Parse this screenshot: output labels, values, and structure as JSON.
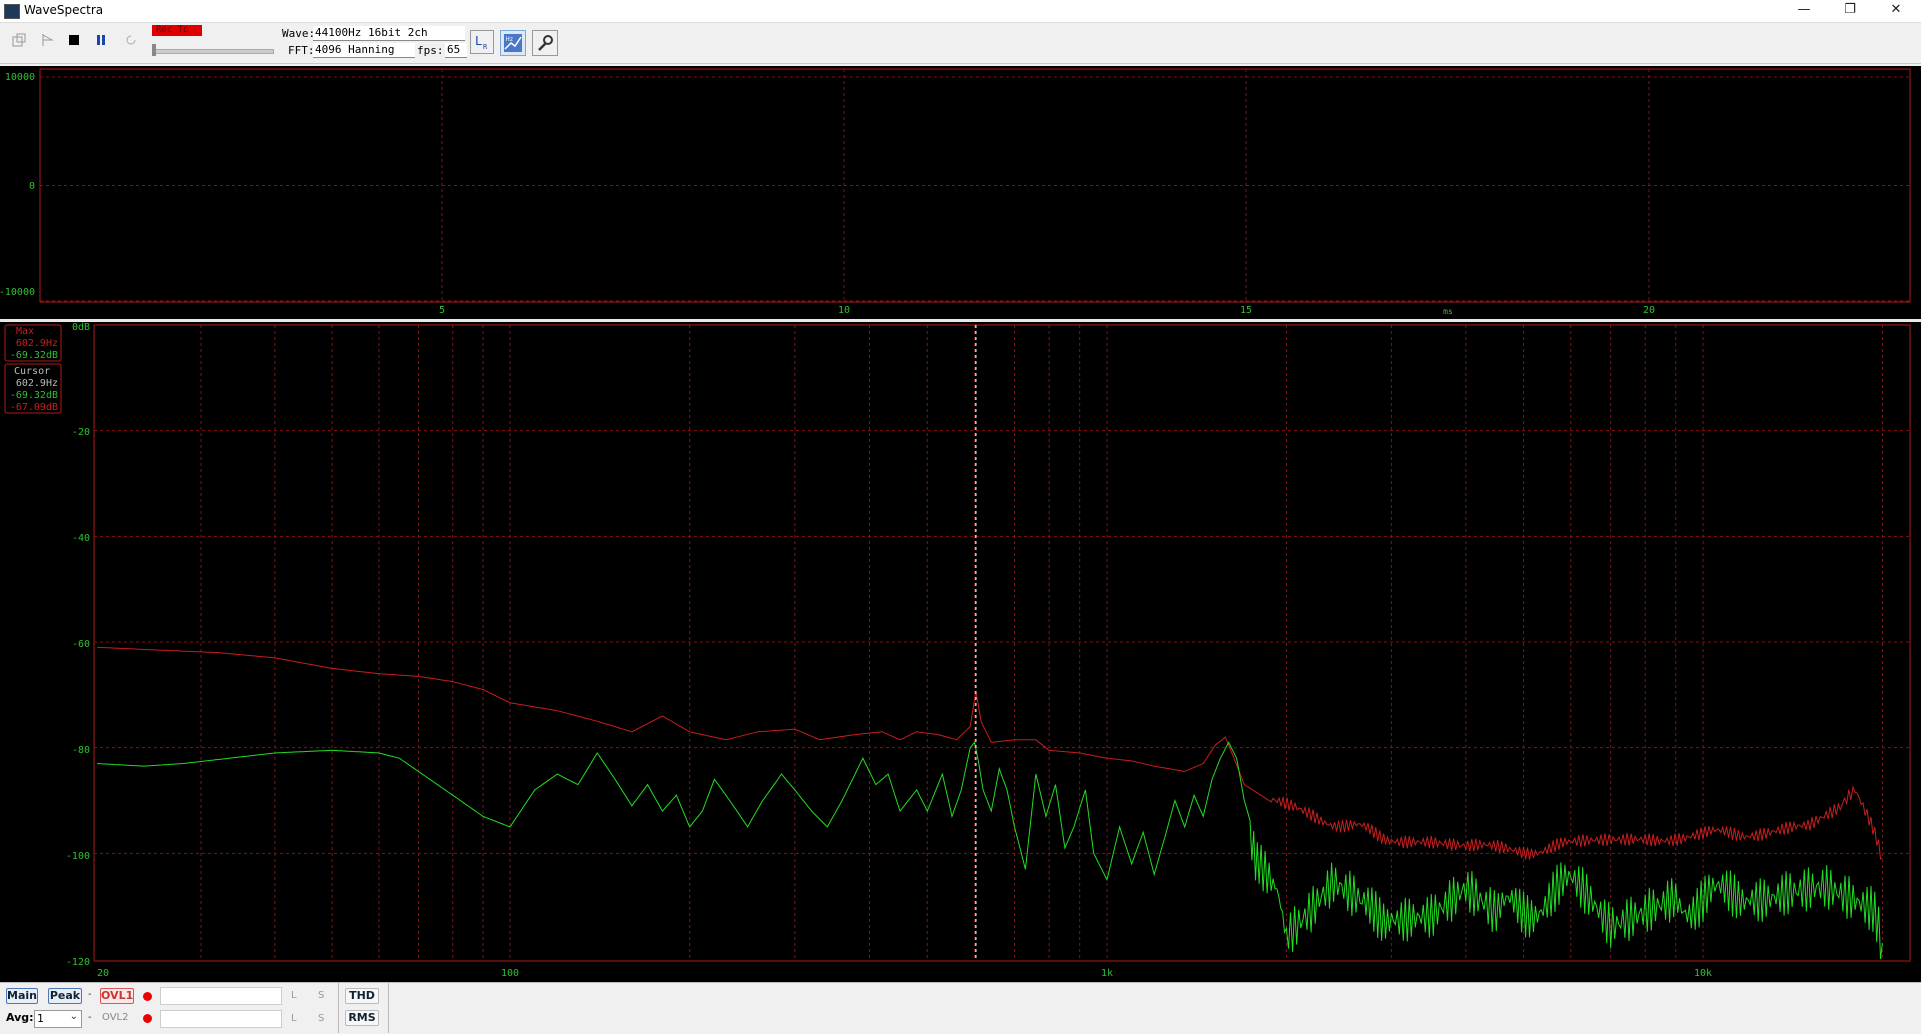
{
  "window": {
    "title": "WaveSpectra",
    "minimize": "—",
    "maximize": "❐",
    "close": "✕"
  },
  "toolbar": {
    "rec_to": "Rec To",
    "wave_label": "Wave:",
    "wave_value": "44100Hz 16bit 2ch",
    "fft_label": "FFT:",
    "fft_value": "4096 Hanning",
    "fps_label": "fps:",
    "fps_value": "65",
    "icons": [
      "open-file-icon",
      "play-icon",
      "stop-icon",
      "pause-icon",
      "reload-icon",
      "channel-lr-icon",
      "frequency-scale-icon",
      "settings-wrench-icon"
    ]
  },
  "wave": {
    "y_labels": [
      "10000",
      "0",
      "-10000"
    ],
    "x_labels": [
      "5",
      "10",
      "15",
      "20"
    ],
    "x_unit": "ms"
  },
  "spectrum": {
    "y_labels": [
      "0dB",
      "-20",
      "-40",
      "-60",
      "-80",
      "-100",
      "-120"
    ],
    "x_labels": [
      "20",
      "100",
      "1k",
      "10k"
    ],
    "max_box": {
      "title": "Max",
      "freq": "602.9Hz",
      "level": "-69.32dB"
    },
    "cursor_box": {
      "title": "Cursor",
      "freq": "602.9Hz",
      "level_l": "-69.32dB",
      "level_r": "-67.09dB"
    },
    "cursor_hz": 602.9,
    "colors": {
      "grid": "#8a1010",
      "frame": "#b01818",
      "left": "#22dd22",
      "right": "#c81e1e",
      "label": "#30c030"
    },
    "series": [
      {
        "channel": "R",
        "points": [
          [
            20,
            -61
          ],
          [
            25,
            -61.5
          ],
          [
            32,
            -62
          ],
          [
            40,
            -63
          ],
          [
            50,
            -65
          ],
          [
            60,
            -66
          ],
          [
            70,
            -66.5
          ],
          [
            80,
            -67.5
          ],
          [
            90,
            -69
          ],
          [
            100,
            -71.5
          ],
          [
            120,
            -73
          ],
          [
            140,
            -75
          ],
          [
            160,
            -77
          ],
          [
            180,
            -74
          ],
          [
            200,
            -77
          ],
          [
            230,
            -78.5
          ],
          [
            260,
            -77
          ],
          [
            300,
            -76.5
          ],
          [
            330,
            -78.5
          ],
          [
            380,
            -77.5
          ],
          [
            420,
            -77
          ],
          [
            450,
            -78.5
          ],
          [
            480,
            -77
          ],
          [
            520,
            -77.5
          ],
          [
            560,
            -78.5
          ],
          [
            590,
            -76
          ],
          [
            603,
            -69.3
          ],
          [
            615,
            -75
          ],
          [
            640,
            -79
          ],
          [
            700,
            -78.5
          ],
          [
            760,
            -78.5
          ],
          [
            800,
            -80.5
          ],
          [
            900,
            -81
          ],
          [
            1000,
            -82
          ],
          [
            1100,
            -82.5
          ],
          [
            1200,
            -83.5
          ],
          [
            1350,
            -84.5
          ],
          [
            1450,
            -83
          ],
          [
            1520,
            -79.5
          ],
          [
            1580,
            -78
          ],
          [
            1640,
            -82.5
          ],
          [
            1700,
            -87
          ],
          [
            1900,
            -90.5
          ],
          [
            2200,
            -93
          ],
          [
            2600,
            -95
          ],
          [
            3000,
            -97
          ],
          [
            3500,
            -98.5
          ],
          [
            4000,
            -99
          ],
          [
            5000,
            -99.5
          ],
          [
            6000,
            -98.5
          ],
          [
            8000,
            -97
          ],
          [
            10000,
            -96.5
          ],
          [
            12000,
            -96
          ],
          [
            15000,
            -95.5
          ],
          [
            17000,
            -92
          ],
          [
            18000,
            -88
          ],
          [
            19000,
            -94
          ],
          [
            20000,
            -101
          ]
        ]
      },
      {
        "channel": "L",
        "points": [
          [
            20,
            -83
          ],
          [
            24,
            -83.5
          ],
          [
            28,
            -83
          ],
          [
            40,
            -81
          ],
          [
            50,
            -80.5
          ],
          [
            60,
            -81
          ],
          [
            65,
            -82
          ],
          [
            80,
            -89
          ],
          [
            90,
            -93
          ],
          [
            100,
            -95
          ],
          [
            110,
            -88
          ],
          [
            120,
            -85
          ],
          [
            130,
            -87
          ],
          [
            140,
            -81
          ],
          [
            150,
            -86
          ],
          [
            160,
            -91
          ],
          [
            170,
            -87
          ],
          [
            180,
            -92
          ],
          [
            190,
            -89
          ],
          [
            200,
            -95
          ],
          [
            210,
            -92
          ],
          [
            220,
            -86
          ],
          [
            230,
            -89
          ],
          [
            240,
            -92
          ],
          [
            250,
            -95
          ],
          [
            265,
            -90
          ],
          [
            285,
            -85
          ],
          [
            300,
            -88
          ],
          [
            320,
            -92
          ],
          [
            340,
            -95
          ],
          [
            360,
            -90
          ],
          [
            390,
            -82
          ],
          [
            410,
            -87
          ],
          [
            430,
            -85
          ],
          [
            450,
            -92
          ],
          [
            480,
            -88
          ],
          [
            500,
            -92
          ],
          [
            530,
            -85
          ],
          [
            550,
            -93
          ],
          [
            570,
            -88
          ],
          [
            590,
            -80
          ],
          [
            600,
            -79
          ],
          [
            610,
            -83
          ],
          [
            620,
            -88
          ],
          [
            640,
            -92
          ],
          [
            660,
            -84
          ],
          [
            680,
            -88
          ],
          [
            700,
            -95
          ],
          [
            730,
            -103
          ],
          [
            760,
            -85
          ],
          [
            790,
            -93
          ],
          [
            820,
            -87
          ],
          [
            850,
            -99
          ],
          [
            880,
            -95
          ],
          [
            920,
            -88
          ],
          [
            950,
            -100
          ],
          [
            1000,
            -105
          ],
          [
            1050,
            -95
          ],
          [
            1100,
            -102
          ],
          [
            1150,
            -96
          ],
          [
            1200,
            -104
          ],
          [
            1250,
            -97
          ],
          [
            1300,
            -90
          ],
          [
            1350,
            -95
          ],
          [
            1400,
            -89
          ],
          [
            1450,
            -93
          ],
          [
            1500,
            -86
          ],
          [
            1550,
            -82
          ],
          [
            1600,
            -79
          ],
          [
            1650,
            -82
          ],
          [
            1700,
            -90
          ],
          [
            1750,
            -95
          ],
          [
            1800,
            -103
          ],
          [
            1900,
            -108
          ],
          [
            2000,
            -114
          ],
          [
            2200,
            -112
          ],
          [
            2400,
            -108
          ],
          [
            2700,
            -112
          ],
          [
            3000,
            -110
          ],
          [
            3500,
            -114
          ],
          [
            4000,
            -108
          ],
          [
            4500,
            -112
          ],
          [
            5000,
            -110
          ],
          [
            6000,
            -107
          ],
          [
            7000,
            -112
          ],
          [
            8000,
            -110
          ],
          [
            9000,
            -108
          ],
          [
            10000,
            -110
          ],
          [
            12000,
            -106
          ],
          [
            14000,
            -109
          ],
          [
            16000,
            -107
          ],
          [
            18000,
            -109
          ],
          [
            19000,
            -112
          ],
          [
            20000,
            -117
          ]
        ]
      }
    ]
  },
  "bottom": {
    "main": "Main",
    "peak": "Peak",
    "dash1": "-",
    "ovl1": "OVL1",
    "dash2": "-",
    "ovl2": "OVL2",
    "avg_label": "Avg:",
    "avg_value": "1",
    "l1": "L",
    "s1": "S",
    "l2": "L",
    "s2": "S",
    "thd": "THD",
    "rms": "RMS"
  }
}
